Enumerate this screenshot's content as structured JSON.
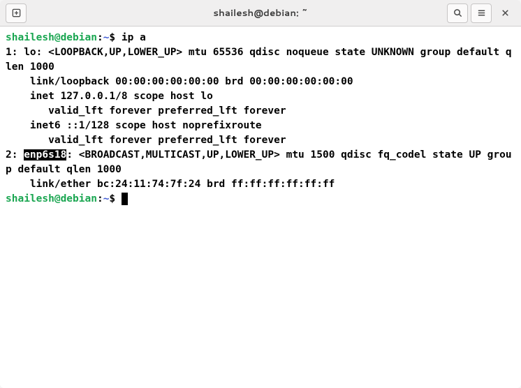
{
  "titlebar": {
    "title": "shailesh@debian: ~",
    "new_tab_icon": "new-tab-icon",
    "search_icon": "search-icon",
    "menu_icon": "hamburger-icon",
    "close_icon": "close-icon"
  },
  "prompt": {
    "user_host": "shailesh@debian",
    "path": "~",
    "symbol": "$"
  },
  "lines": {
    "cmd1": "ip a",
    "l1": "1: lo: <LOOPBACK,UP,LOWER_UP> mtu 65536 qdisc noqueue state UNKNOWN group default qlen 1000",
    "l2": "    link/loopback 00:00:00:00:00:00 brd 00:00:00:00:00:00",
    "l3": "    inet 127.0.0.1/8 scope host lo",
    "l4": "       valid_lft forever preferred_lft forever",
    "l5": "    inet6 ::1/128 scope host noprefixroute",
    "l6": "       valid_lft forever preferred_lft forever",
    "l7_pre": "2: ",
    "l7_iface": "enp6s18",
    "l7_post": ": <BROADCAST,MULTICAST,UP,LOWER_UP> mtu 1500 qdisc fq_codel state UP group default qlen 1000",
    "l8": "    link/ether bc:24:11:74:7f:24 brd ff:ff:ff:ff:ff:ff"
  }
}
